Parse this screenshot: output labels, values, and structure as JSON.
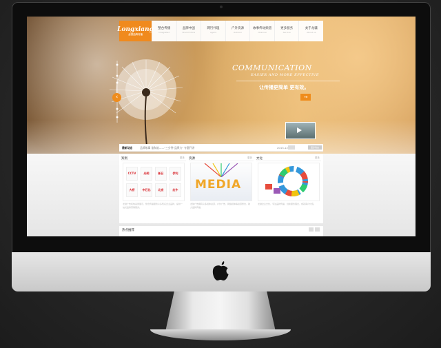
{
  "site": {
    "logo_text": "Longxiang",
    "logo_sub": "龙骧品牌传播",
    "nav": [
      {
        "cn": "整合传播",
        "en": "Integrated"
      },
      {
        "cn": "品牌中国",
        "en": "Brand China"
      },
      {
        "cn": "网行代理",
        "en": "Agent"
      },
      {
        "cn": "户外资源",
        "en": "Outdoor"
      },
      {
        "cn": "故事传动频道",
        "en": "Channel"
      },
      {
        "cn": "更多服务",
        "en": "Service"
      },
      {
        "cn": "关于龙骧",
        "en": "About us"
      }
    ]
  },
  "hero": {
    "headline": "COMMUNICATION",
    "subline": "EASIER AND MORE EFFECTIVE",
    "cn_tagline": "让传播更简单 更有效。",
    "arrow": "→"
  },
  "news": {
    "title": "最新动态",
    "text": "品牌故事 谁和谁——\"三分钟 品牌力\" 专题开讲",
    "date": "2013-12-17",
    "more": "更多动态"
  },
  "columns": [
    {
      "title": "案例",
      "more": "更多",
      "text": "龙骧广告机构案例展示，整合传播服务众多知名企业品牌，提供一站式品牌营销服务。"
    },
    {
      "title": "资源",
      "more": "更多",
      "text": "龙骧广告拥有众多媒体资源，户外广告、网络媒体等资源整合，助力品牌传播。"
    },
    {
      "title": "文化",
      "more": "更多",
      "text": "龙骧企业文化，专注品牌传播，创新服务理念，成就客户价值。"
    }
  ],
  "client_logos": [
    "CCTV",
    "光明",
    "新日",
    "伊利",
    "大桥",
    "中石化",
    "北京",
    "红牛"
  ],
  "media_word": "MEDIA",
  "hot": {
    "label": "热点推荐"
  },
  "colors": {
    "accent": "#ef8c1c",
    "brand": "#f08a1d"
  }
}
